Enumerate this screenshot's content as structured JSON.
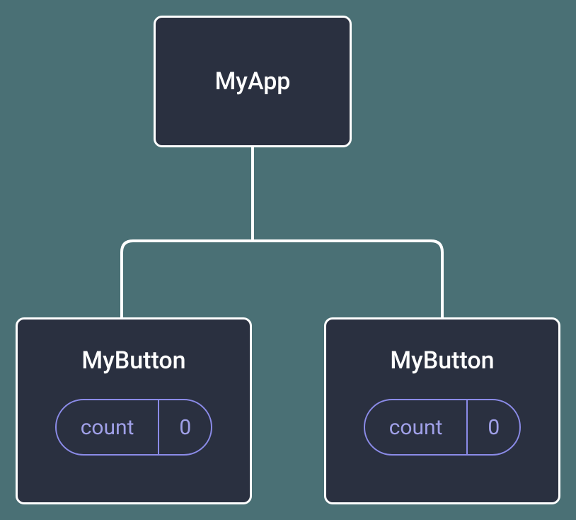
{
  "tree": {
    "root": {
      "label": "MyApp"
    },
    "children": [
      {
        "label": "MyButton",
        "state": {
          "name": "count",
          "value": "0"
        }
      },
      {
        "label": "MyButton",
        "state": {
          "name": "count",
          "value": "0"
        }
      }
    ]
  },
  "colors": {
    "background": "#4a7075",
    "node_fill": "#2a3040",
    "node_border": "#ffffff",
    "pill_border": "#8b8be8",
    "pill_text": "#a0a0e8",
    "connector": "#ffffff"
  }
}
